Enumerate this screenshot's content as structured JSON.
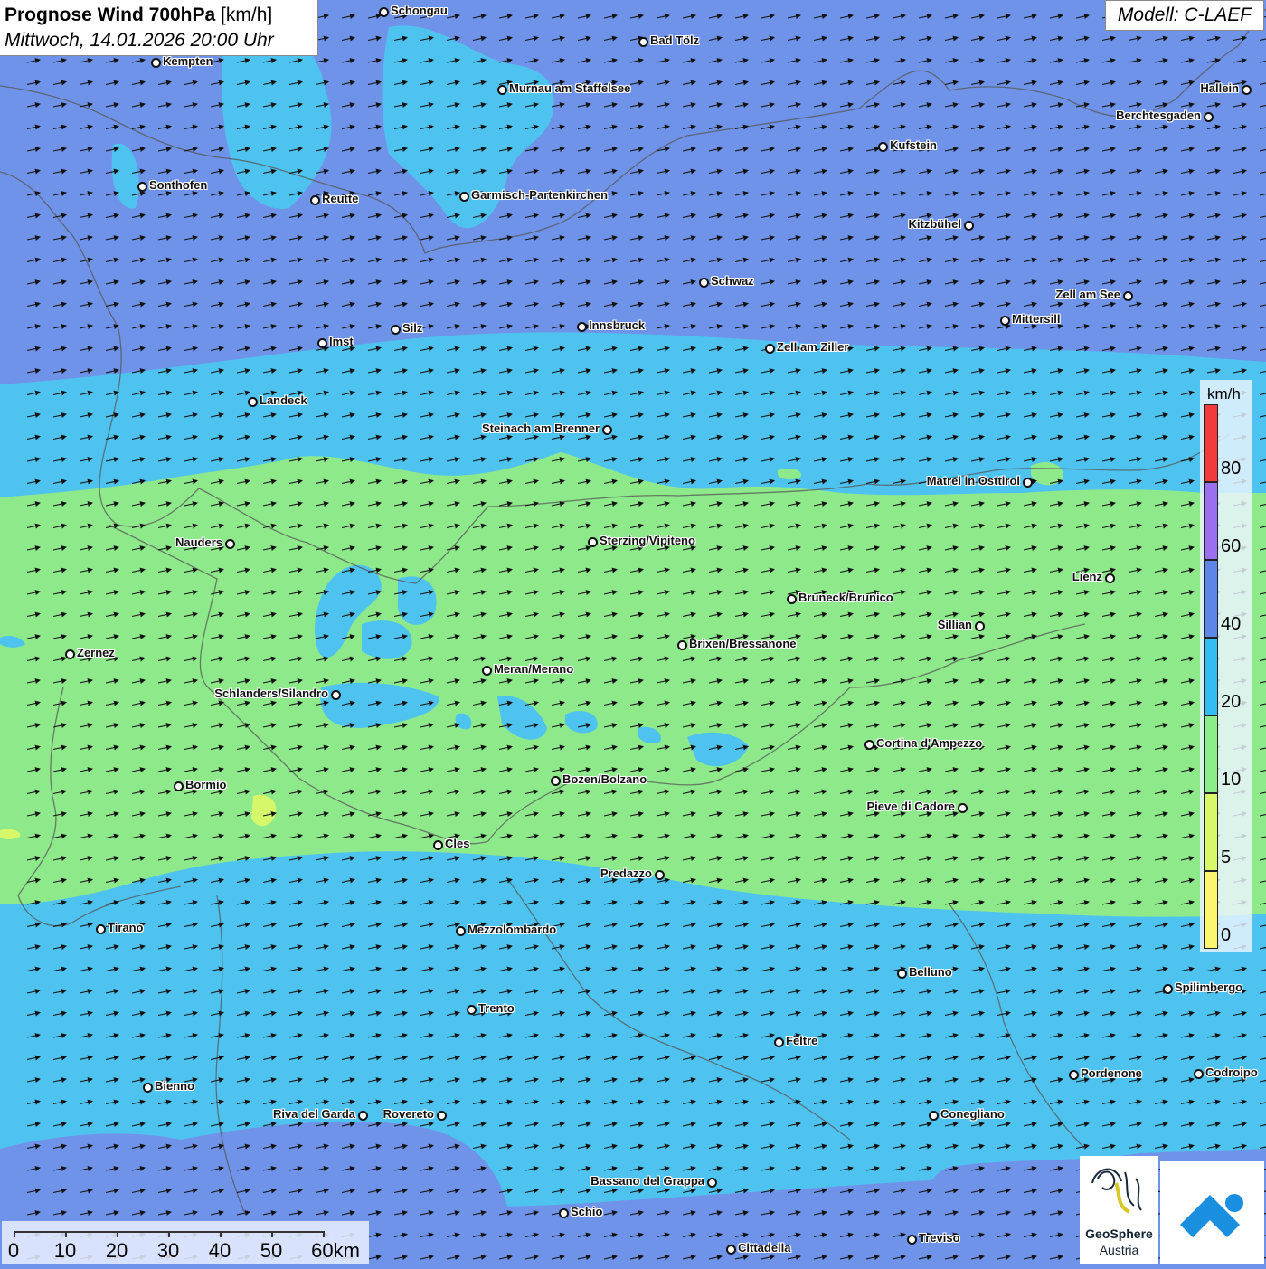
{
  "title": {
    "bold": "Prognose Wind 700hPa",
    "unit": "[km/h]",
    "datetime": "Mittwoch, 14.01.2026 20:00 Uhr"
  },
  "model": "Modell: C-LAEF",
  "legend": {
    "unit": "km/h",
    "ticks": [
      "80",
      "60",
      "40",
      "20",
      "10",
      "5",
      "0"
    ],
    "colors": [
      "#f23b3b",
      "#9a6ff0",
      "#5d86e6",
      "#33bdf0",
      "#8cee88",
      "#d8f86a",
      "#fbf66e"
    ]
  },
  "wind_field": {
    "direction": "west-southwest to east-northeast",
    "zones": [
      {
        "band": "north",
        "speed_class": "40-60",
        "color": "#6f93e8"
      },
      {
        "band": "inner-north",
        "speed_class": "20-40",
        "color": "#4fc3f0"
      },
      {
        "band": "central",
        "speed_class": "10-20",
        "color": "#8ee98b"
      },
      {
        "band": "south",
        "speed_class": "20-40",
        "color": "#4fc3f0"
      }
    ]
  },
  "cities": [
    {
      "name": "Schongau"
    },
    {
      "name": "Bad Tölz"
    },
    {
      "name": "Kempten"
    },
    {
      "name": "Murnau am Staffelsee"
    },
    {
      "name": "Hallein"
    },
    {
      "name": "Berchtesgaden"
    },
    {
      "name": "Kufstein"
    },
    {
      "name": "Sonthofen"
    },
    {
      "name": "Reutte"
    },
    {
      "name": "Garmisch-Partenkirchen"
    },
    {
      "name": "Kitzbühel"
    },
    {
      "name": "Schwaz"
    },
    {
      "name": "Zell am See"
    },
    {
      "name": "Mittersill"
    },
    {
      "name": "Imst"
    },
    {
      "name": "Silz"
    },
    {
      "name": "Innsbruck"
    },
    {
      "name": "Zell am Ziller"
    },
    {
      "name": "Landeck"
    },
    {
      "name": "Steinach am Brenner"
    },
    {
      "name": "Matrei in Osttirol"
    },
    {
      "name": "Nauders"
    },
    {
      "name": "Sterzing/Vipiteno"
    },
    {
      "name": "Lienz"
    },
    {
      "name": "Bruneck/Brunico"
    },
    {
      "name": "Sillian"
    },
    {
      "name": "Zernez"
    },
    {
      "name": "Brixen/Bressanone"
    },
    {
      "name": "Meran/Merano"
    },
    {
      "name": "Schlanders/Silandro"
    },
    {
      "name": "Cortina d'Ampezzo"
    },
    {
      "name": "Bozen/Bolzano"
    },
    {
      "name": "Bormio"
    },
    {
      "name": "Pieve di Cadore"
    },
    {
      "name": "Cles"
    },
    {
      "name": "Predazzo"
    },
    {
      "name": "Tirano"
    },
    {
      "name": "Mezzolombardo"
    },
    {
      "name": "Belluno"
    },
    {
      "name": "Spilimbergo"
    },
    {
      "name": "Trento"
    },
    {
      "name": "Feltre"
    },
    {
      "name": "Pordenone"
    },
    {
      "name": "Codroipo"
    },
    {
      "name": "Bienno"
    },
    {
      "name": "Riva del Garda"
    },
    {
      "name": "Rovereto"
    },
    {
      "name": "Conegliano"
    },
    {
      "name": "Bassano del Grappa"
    },
    {
      "name": "Schio"
    },
    {
      "name": "Treviso"
    },
    {
      "name": "Cittadella"
    }
  ],
  "scalebar": {
    "labels": [
      "0",
      "10",
      "20",
      "30",
      "40",
      "50",
      "60km"
    ]
  },
  "logo": {
    "name": "GeoSphere",
    "sub": "Austria"
  }
}
